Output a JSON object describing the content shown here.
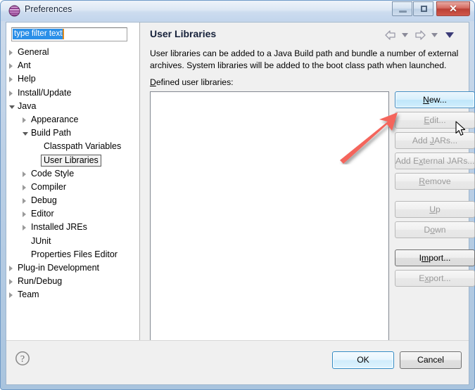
{
  "window": {
    "title": "Preferences",
    "icon": "eclipse-sphere-icon",
    "controls": {
      "minimize": "minimize-icon",
      "maximize": "maximize-icon",
      "close": "close-icon",
      "close_glyph": "✕"
    }
  },
  "filter": {
    "value": "type filter text",
    "placeholder": "type filter text"
  },
  "tree": {
    "items": [
      {
        "label": "General",
        "indent": 16,
        "state": "collapsed",
        "selected": false
      },
      {
        "label": "Ant",
        "indent": 16,
        "state": "collapsed",
        "selected": false
      },
      {
        "label": "Help",
        "indent": 16,
        "state": "collapsed",
        "selected": false
      },
      {
        "label": "Install/Update",
        "indent": 16,
        "state": "collapsed",
        "selected": false
      },
      {
        "label": "Java",
        "indent": 16,
        "state": "expanded",
        "selected": false
      },
      {
        "label": "Appearance",
        "indent": 35,
        "state": "collapsed",
        "selected": false
      },
      {
        "label": "Build Path",
        "indent": 35,
        "state": "expanded",
        "selected": false
      },
      {
        "label": "Classpath Variables",
        "indent": 53,
        "state": "leaf",
        "selected": false
      },
      {
        "label": "User Libraries",
        "indent": 53,
        "state": "leaf",
        "selected": true
      },
      {
        "label": "Code Style",
        "indent": 35,
        "state": "collapsed",
        "selected": false
      },
      {
        "label": "Compiler",
        "indent": 35,
        "state": "collapsed",
        "selected": false
      },
      {
        "label": "Debug",
        "indent": 35,
        "state": "collapsed",
        "selected": false
      },
      {
        "label": "Editor",
        "indent": 35,
        "state": "collapsed",
        "selected": false
      },
      {
        "label": "Installed JREs",
        "indent": 35,
        "state": "collapsed",
        "selected": false
      },
      {
        "label": "JUnit",
        "indent": 35,
        "state": "leaf",
        "selected": false
      },
      {
        "label": "Properties Files Editor",
        "indent": 35,
        "state": "leaf",
        "selected": false
      },
      {
        "label": "Plug-in Development",
        "indent": 16,
        "state": "collapsed",
        "selected": false
      },
      {
        "label": "Run/Debug",
        "indent": 16,
        "state": "collapsed",
        "selected": false
      },
      {
        "label": "Team",
        "indent": 16,
        "state": "collapsed",
        "selected": false
      }
    ]
  },
  "page": {
    "title": "User Libraries",
    "description": "User libraries can be added to a Java Build path and bundle a number of external archives. System libraries will be added to the boot class path when launched.",
    "list_label_prefix": "D",
    "list_label_rest": "efined user libraries:",
    "list_items": [],
    "nav": {
      "back": "back-arrow-icon",
      "back_menu": "chevron-down-icon",
      "forward": "forward-arrow-icon",
      "forward_menu": "chevron-down-icon",
      "view_menu": "chevron-down-icon"
    }
  },
  "side_buttons": [
    {
      "name": "new-button",
      "pre": "",
      "accel": "N",
      "post": "ew...",
      "state": "focused"
    },
    {
      "name": "edit-button",
      "pre": "",
      "accel": "E",
      "post": "dit...",
      "state": "disabled"
    },
    {
      "name": "add-jars-button",
      "pre": "Add ",
      "accel": "J",
      "post": "ARs...",
      "state": "disabled"
    },
    {
      "name": "add-external-jars-button",
      "pre": "Add E",
      "accel": "x",
      "post": "ternal JARs...",
      "state": "disabled"
    },
    {
      "name": "remove-button",
      "pre": "",
      "accel": "R",
      "post": "emove",
      "state": "disabled"
    },
    {
      "name": "up-button",
      "pre": "",
      "accel": "U",
      "post": "p",
      "state": "disabled"
    },
    {
      "name": "down-button",
      "pre": "D",
      "accel": "o",
      "post": "wn",
      "state": "disabled"
    },
    {
      "name": "import-button",
      "pre": "I",
      "accel": "m",
      "post": "port...",
      "state": "enabled"
    },
    {
      "name": "export-button",
      "pre": "E",
      "accel": "x",
      "post": "port...",
      "state": "disabled"
    }
  ],
  "bottom": {
    "help": "help-icon",
    "ok_label": "OK",
    "cancel_label": "Cancel"
  },
  "annotation": {
    "arrow": "red-pointer-arrow",
    "color": "#f4655c",
    "target": "new-button"
  },
  "colors": {
    "accent": "#2a8fe8",
    "title_bar": "#cddcef",
    "dialog_bg": "#f0f0f0",
    "selection": "#2a8fe8",
    "annotation_red": "#f4655c"
  }
}
